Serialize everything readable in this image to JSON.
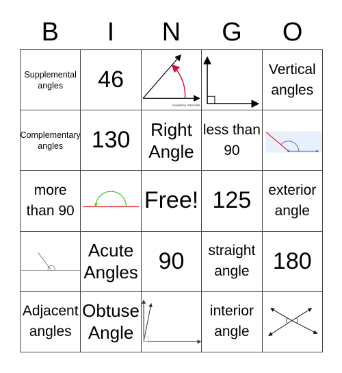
{
  "header": [
    "B",
    "I",
    "N",
    "G",
    "O"
  ],
  "cells": [
    {
      "type": "text",
      "text": "Supplemental angles",
      "size": "xs"
    },
    {
      "type": "text",
      "text": "46",
      "size": "xl"
    },
    {
      "type": "image",
      "icon": "acute-angle-diagram",
      "caption": "Academy Artworks"
    },
    {
      "type": "image",
      "icon": "right-angle-diagram"
    },
    {
      "type": "text",
      "text": "Vertical angles",
      "size": "md"
    },
    {
      "type": "text",
      "text": "Complementary angles",
      "size": "xs"
    },
    {
      "type": "text",
      "text": "130",
      "size": "xl"
    },
    {
      "type": "text",
      "text": "Right Angle",
      "size": "lg"
    },
    {
      "type": "text",
      "text": "less than 90",
      "size": "md"
    },
    {
      "type": "image",
      "icon": "obtuse-angle-diagram"
    },
    {
      "type": "text",
      "text": "more than 90",
      "size": "md"
    },
    {
      "type": "image",
      "icon": "straight-angle-diagram"
    },
    {
      "type": "text",
      "text": "Free!",
      "size": "xl"
    },
    {
      "type": "text",
      "text": "125",
      "size": "xl"
    },
    {
      "type": "text",
      "text": "exterior angle",
      "size": "md"
    },
    {
      "type": "image",
      "icon": "reflex-angle-diagram"
    },
    {
      "type": "text",
      "text": "Acute Angles",
      "size": "lg"
    },
    {
      "type": "text",
      "text": "90",
      "size": "xl"
    },
    {
      "type": "text",
      "text": "straight angle",
      "size": "md"
    },
    {
      "type": "text",
      "text": "180",
      "size": "xl"
    },
    {
      "type": "text",
      "text": "Adjacent angles",
      "size": "md"
    },
    {
      "type": "text",
      "text": "Obtuse Angle",
      "size": "lg"
    },
    {
      "type": "image",
      "icon": "complementary-angles-diagram"
    },
    {
      "type": "text",
      "text": "interior angle",
      "size": "md"
    },
    {
      "type": "image",
      "icon": "vertical-angles-diagram"
    }
  ],
  "colors": {
    "arc_red": "#d0103a",
    "line_red": "#e02020",
    "arc_green": "#22cc22",
    "arc_blue": "#5060d0",
    "panel_blue": "#e8f0fb"
  }
}
